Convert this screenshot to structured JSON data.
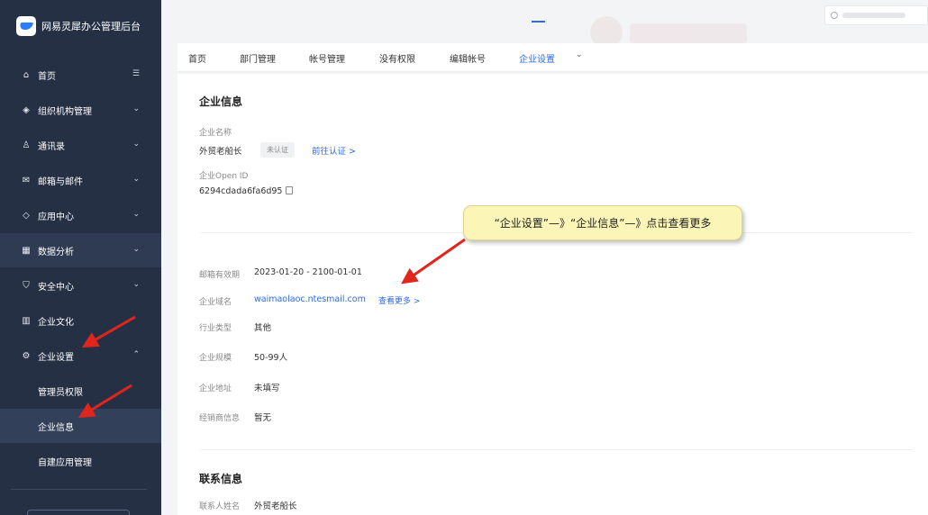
{
  "app": {
    "title": "网易灵犀办公管理后台"
  },
  "sidebar": {
    "items": [
      {
        "label": "首页",
        "icon": "home-icon",
        "chev": "☰"
      },
      {
        "label": "组织机构管理",
        "icon": "layers-icon",
        "chev": "⌄"
      },
      {
        "label": "通讯录",
        "icon": "contacts-icon",
        "chev": "⌄"
      },
      {
        "label": "邮箱与邮件",
        "icon": "mail-icon",
        "chev": "⌄"
      },
      {
        "label": "应用中心",
        "icon": "apps-icon",
        "chev": "⌄"
      },
      {
        "label": "数据分析",
        "icon": "chart-icon",
        "chev": "⌄"
      },
      {
        "label": "安全中心",
        "icon": "shield-icon",
        "chev": "⌄"
      },
      {
        "label": "企业文化",
        "icon": "culture-icon",
        "chev": ""
      },
      {
        "label": "企业设置",
        "icon": "gear-icon",
        "chev": "⌃"
      }
    ],
    "sub_items": [
      {
        "label": "管理员权限"
      },
      {
        "label": "企业信息"
      },
      {
        "label": "自建应用管理"
      }
    ]
  },
  "search": {
    "placeholder": ""
  },
  "tabs": [
    {
      "label": "首页"
    },
    {
      "label": "部门管理"
    },
    {
      "label": "帐号管理"
    },
    {
      "label": "没有权限"
    },
    {
      "label": "编辑帐号"
    },
    {
      "label": "企业设置"
    }
  ],
  "company_info": {
    "title": "企业信息",
    "name_label": "企业名称",
    "name_value": "外贸老船长",
    "cert_badge": "未认证",
    "cert_link": "前往认证 >",
    "openid_label": "企业Open ID",
    "openid_value": "6294cdada6fa6d95"
  },
  "details": {
    "validity_label": "邮箱有效期",
    "validity_value": "2023-01-20 - 2100-01-01",
    "domain_label": "企业域名",
    "domain_value": "waimaolaoc.ntesmail.com",
    "domain_more": "查看更多 >",
    "industry_label": "行业类型",
    "industry_value": "其他",
    "scale_label": "企业规模",
    "scale_value": "50-99人",
    "address_label": "企业地址",
    "address_value": "未填写",
    "dealer_label": "经销商信息",
    "dealer_value": "暂无"
  },
  "contact": {
    "title": "联系信息",
    "name_label": "联系人姓名",
    "name_value": "外贸老船长"
  },
  "callout": {
    "text": "“企业设置”—》“企业信息”—》点击查看更多"
  },
  "colors": {
    "sidebar_bg": "#253045",
    "accent": "#2f6be0",
    "annotation_arrow": "#e0261c",
    "callout_bg": "#fbf6b8"
  }
}
